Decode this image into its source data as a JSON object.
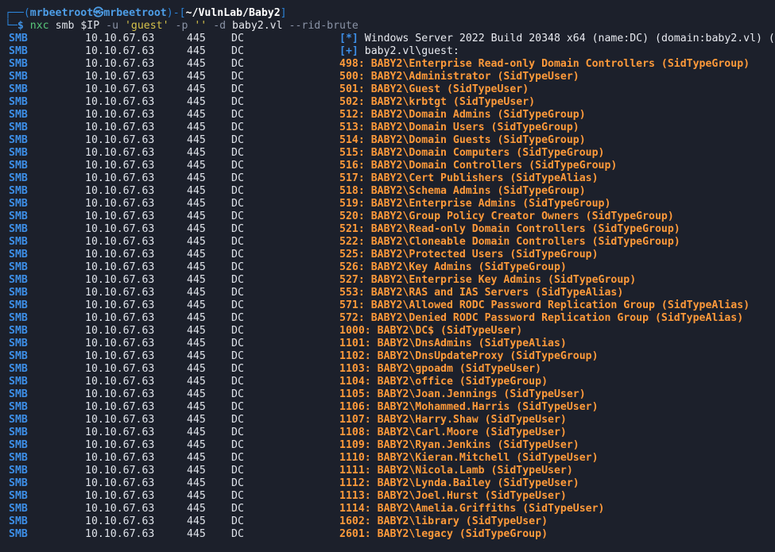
{
  "prompt": {
    "corner_top": "┌──(",
    "user": "mrbeetroot㉿mrbeetroot",
    "sep": ")-[",
    "path": "~/VulnLab/Baby2",
    "close": "]",
    "corner_bottom": "└─",
    "dollar": "$",
    "cmd_tool": "nxc",
    "cmd_proto": "smb",
    "cmd_var": "$IP",
    "opt_u": "-u",
    "user_str": "'guest'",
    "opt_p": "-p",
    "pass_str": "''",
    "opt_d": "-d",
    "domain": "baby2.vl",
    "opt_rid": "--rid-brute"
  },
  "columns": {
    "proto": "SMB",
    "ip": "10.10.67.63",
    "port": "445",
    "host": "DC"
  },
  "header_rows": [
    {
      "tag": "[*]",
      "text": "Windows Server 2022 Build 20348 x64 (name:DC) (domain:baby2.vl) ("
    },
    {
      "tag": "[+]",
      "text": "baby2.vl\\guest:"
    }
  ],
  "rid_rows": [
    "498: BABY2\\Enterprise Read-only Domain Controllers (SidTypeGroup)",
    "500: BABY2\\Administrator (SidTypeUser)",
    "501: BABY2\\Guest (SidTypeUser)",
    "502: BABY2\\krbtgt (SidTypeUser)",
    "512: BABY2\\Domain Admins (SidTypeGroup)",
    "513: BABY2\\Domain Users (SidTypeGroup)",
    "514: BABY2\\Domain Guests (SidTypeGroup)",
    "515: BABY2\\Domain Computers (SidTypeGroup)",
    "516: BABY2\\Domain Controllers (SidTypeGroup)",
    "517: BABY2\\Cert Publishers (SidTypeAlias)",
    "518: BABY2\\Schema Admins (SidTypeGroup)",
    "519: BABY2\\Enterprise Admins (SidTypeGroup)",
    "520: BABY2\\Group Policy Creator Owners (SidTypeGroup)",
    "521: BABY2\\Read-only Domain Controllers (SidTypeGroup)",
    "522: BABY2\\Cloneable Domain Controllers (SidTypeGroup)",
    "525: BABY2\\Protected Users (SidTypeGroup)",
    "526: BABY2\\Key Admins (SidTypeGroup)",
    "527: BABY2\\Enterprise Key Admins (SidTypeGroup)",
    "553: BABY2\\RAS and IAS Servers (SidTypeAlias)",
    "571: BABY2\\Allowed RODC Password Replication Group (SidTypeAlias)",
    "572: BABY2\\Denied RODC Password Replication Group (SidTypeAlias)",
    "1000: BABY2\\DC$ (SidTypeUser)",
    "1101: BABY2\\DnsAdmins (SidTypeAlias)",
    "1102: BABY2\\DnsUpdateProxy (SidTypeGroup)",
    "1103: BABY2\\gpoadm (SidTypeUser)",
    "1104: BABY2\\office (SidTypeGroup)",
    "1105: BABY2\\Joan.Jennings (SidTypeUser)",
    "1106: BABY2\\Mohammed.Harris (SidTypeUser)",
    "1107: BABY2\\Harry.Shaw (SidTypeUser)",
    "1108: BABY2\\Carl.Moore (SidTypeUser)",
    "1109: BABY2\\Ryan.Jenkins (SidTypeUser)",
    "1110: BABY2\\Kieran.Mitchell (SidTypeUser)",
    "1111: BABY2\\Nicola.Lamb (SidTypeUser)",
    "1112: BABY2\\Lynda.Bailey (SidTypeUser)",
    "1113: BABY2\\Joel.Hurst (SidTypeUser)",
    "1114: BABY2\\Amelia.Griffiths (SidTypeUser)",
    "1602: BABY2\\library (SidTypeUser)",
    "2601: BABY2\\legacy (SidTypeGroup)"
  ],
  "colors": {
    "background": "#1c202b",
    "prompt_blue": "#2c83d8",
    "smb_blue": "#3d8fe8",
    "orange": "#ff9a3a",
    "string_yellow": "#d6c24a",
    "tool_green": "#58c77a"
  }
}
